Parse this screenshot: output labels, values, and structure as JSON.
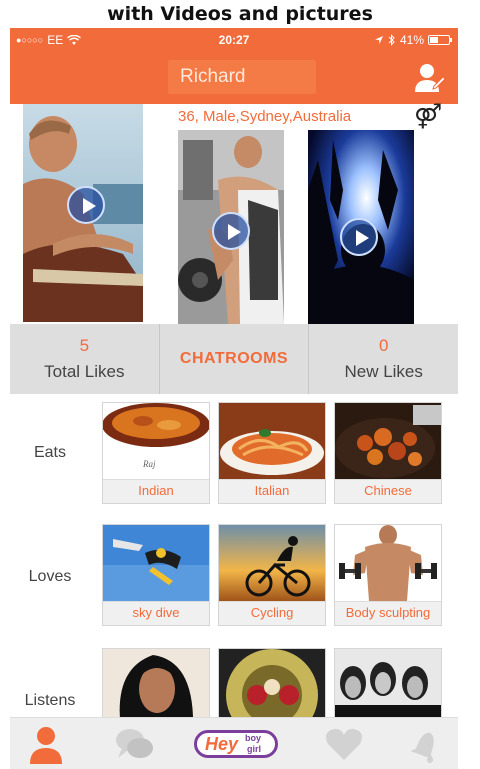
{
  "caption": "with Videos and pictures",
  "status_bar": {
    "carrier_dots": "●○○○○",
    "carrier": "EE",
    "time": "20:27",
    "battery": "41%"
  },
  "header": {
    "name": "Richard"
  },
  "profile": {
    "info": "36, Male,Sydney,Australia"
  },
  "stats": {
    "total_likes_value": "5",
    "total_likes_label": "Total Likes",
    "chatrooms_label": "CHATROOMS",
    "new_likes_value": "0",
    "new_likes_label": "New Likes"
  },
  "sections": {
    "eats": {
      "label": "Eats",
      "items": [
        "Indian",
        "Italian",
        "Chinese"
      ],
      "indian_sign": "Raj"
    },
    "loves": {
      "label": "Loves",
      "items": [
        "sky dive",
        "Cycling",
        "Body sculpting"
      ]
    },
    "listens": {
      "label": "Listens"
    }
  },
  "tabbar": {
    "logo_hey": "Hey",
    "logo_boy": "boy",
    "logo_girl": "girl"
  },
  "colors": {
    "accent": "#f26b3a",
    "logo_purple": "#7b3f9b"
  },
  "icons": [
    "wifi-icon",
    "location-arrow-icon",
    "bluetooth-icon",
    "battery-icon",
    "edit-profile-icon",
    "gender-icon",
    "play-icon",
    "profile-tab-icon",
    "chat-tab-icon",
    "heart-tab-icon",
    "bell-tab-icon"
  ]
}
